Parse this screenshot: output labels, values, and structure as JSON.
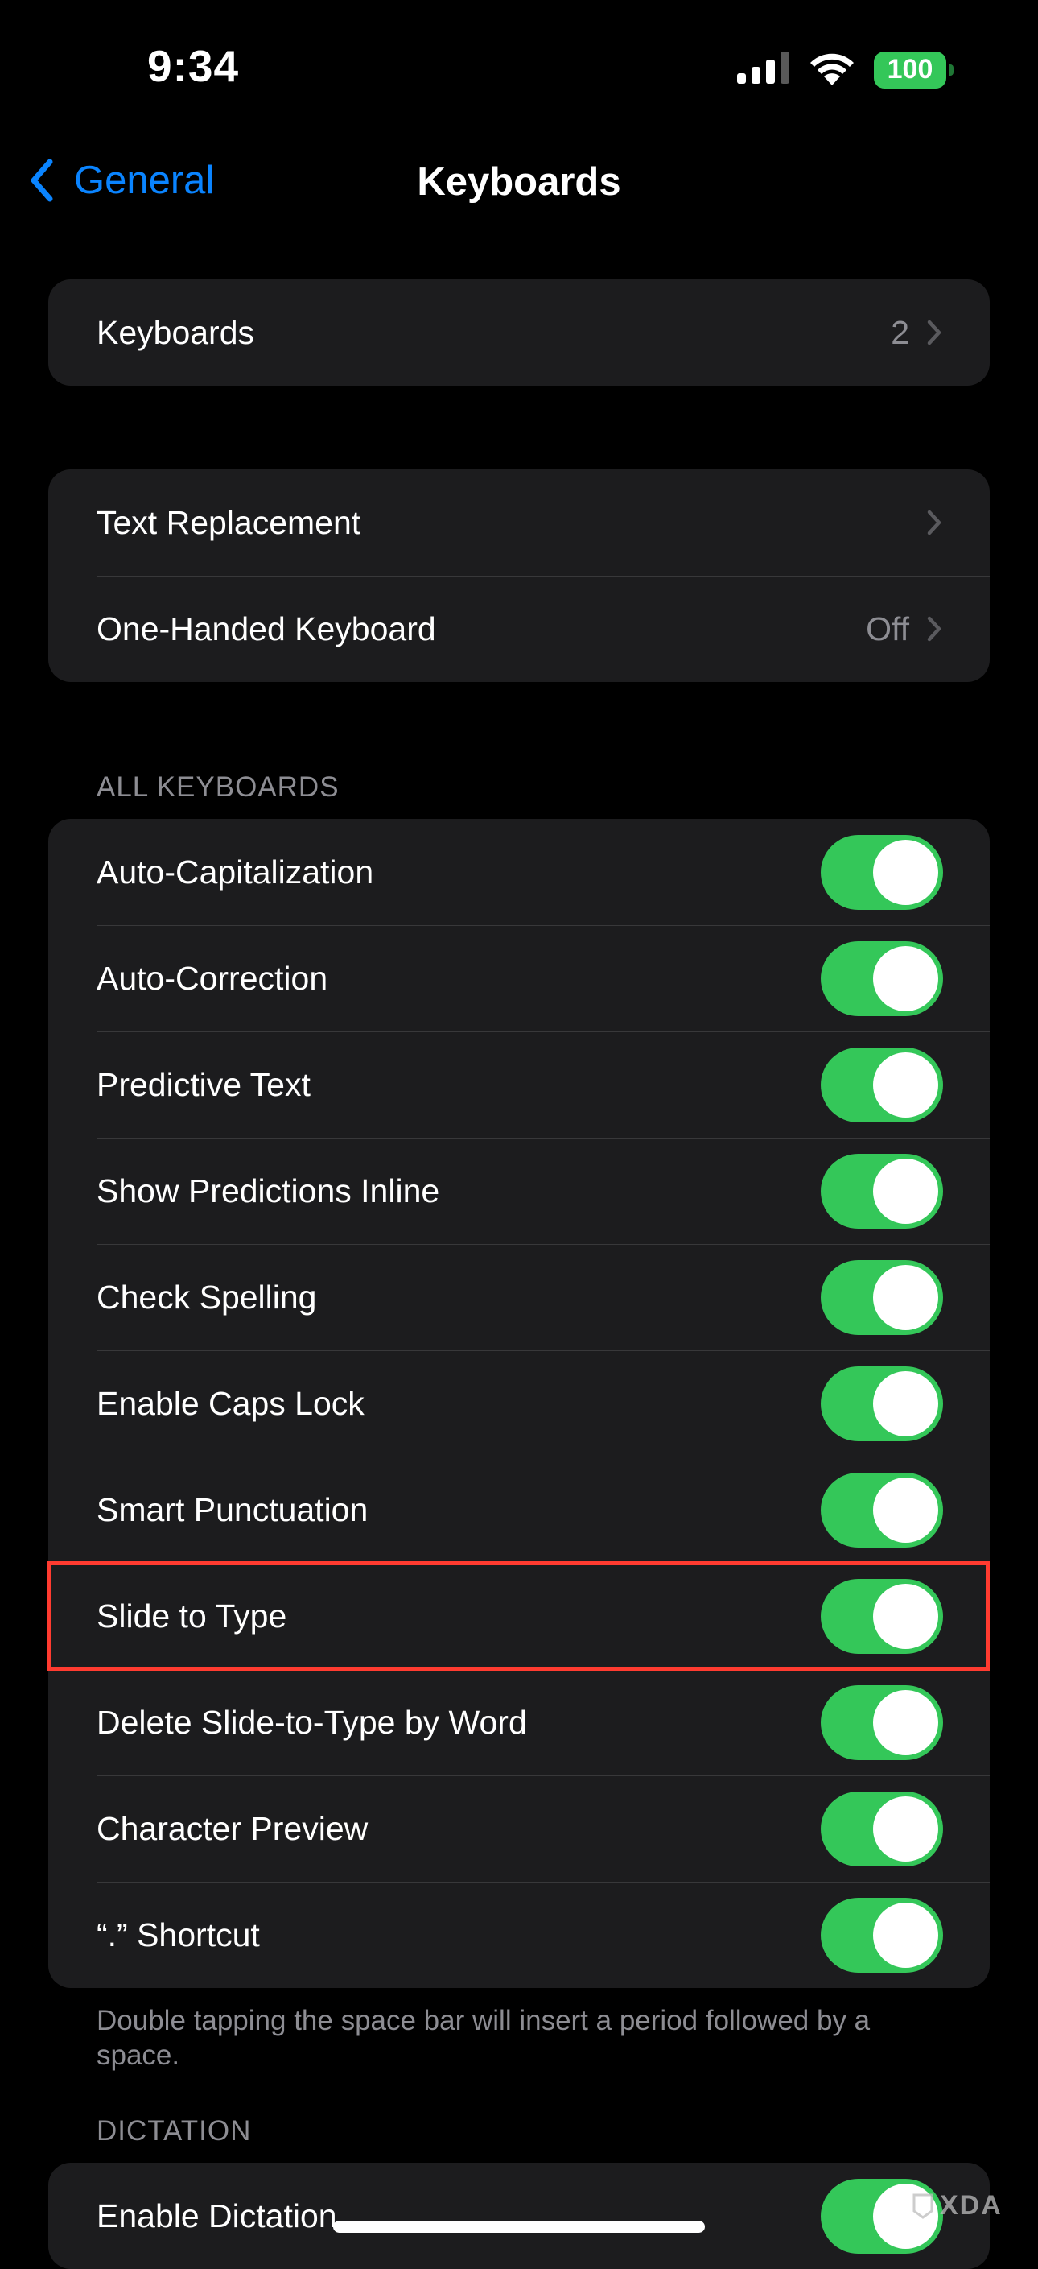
{
  "status_bar": {
    "time": "9:34",
    "battery": "100"
  },
  "nav": {
    "back_label": "General",
    "title": "Keyboards"
  },
  "group_keyboards": {
    "label": "Keyboards",
    "value": "2"
  },
  "group_text": {
    "items": [
      {
        "label": "Text Replacement",
        "value": ""
      },
      {
        "label": "One-Handed Keyboard",
        "value": "Off"
      }
    ]
  },
  "all_keyboards": {
    "header": "ALL KEYBOARDS",
    "items": [
      {
        "label": "Auto-Capitalization",
        "on": true
      },
      {
        "label": "Auto-Correction",
        "on": true
      },
      {
        "label": "Predictive Text",
        "on": true
      },
      {
        "label": "Show Predictions Inline",
        "on": true
      },
      {
        "label": "Check Spelling",
        "on": true
      },
      {
        "label": "Enable Caps Lock",
        "on": true
      },
      {
        "label": "Smart Punctuation",
        "on": true
      },
      {
        "label": "Slide to Type",
        "on": true
      },
      {
        "label": "Delete Slide-to-Type by Word",
        "on": true
      },
      {
        "label": "Character Preview",
        "on": true
      },
      {
        "label": "“.” Shortcut",
        "on": true
      }
    ],
    "footer": "Double tapping the space bar will insert a period followed by a space."
  },
  "dictation": {
    "header": "DICTATION",
    "items": [
      {
        "label": "Enable Dictation",
        "on": true
      }
    ]
  },
  "watermark": "XDA",
  "colors": {
    "accent": "#0a84ff",
    "toggle_on": "#34c759",
    "highlight": "#ff3b30",
    "cell_bg": "#1c1c1e"
  }
}
